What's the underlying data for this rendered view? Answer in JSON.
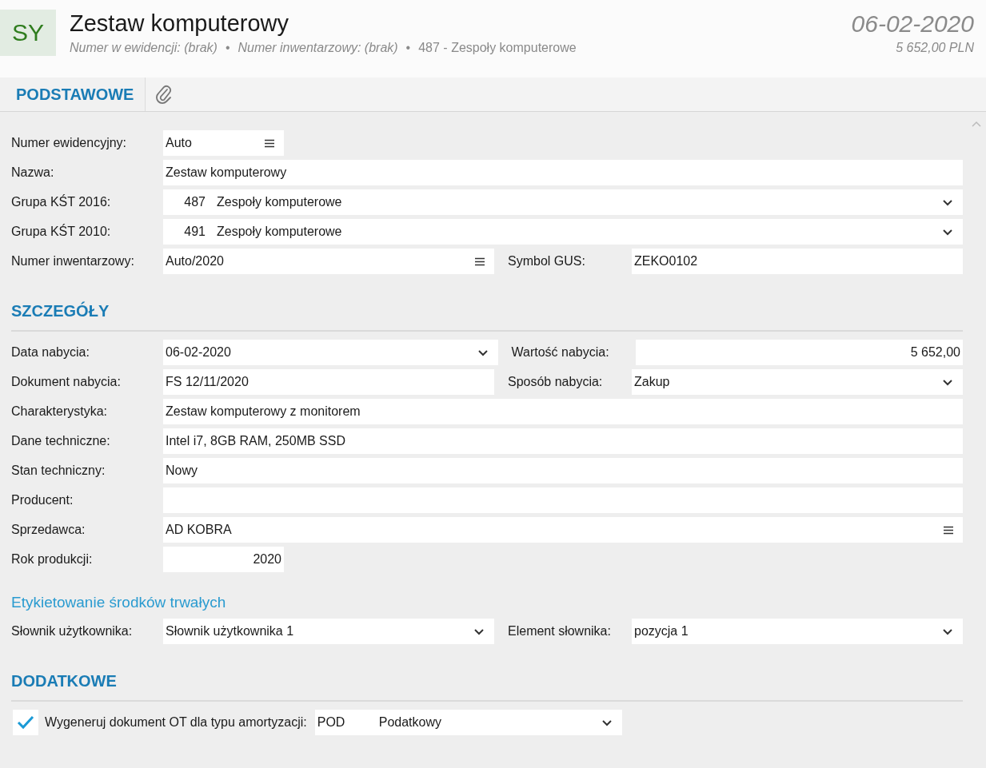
{
  "header": {
    "avatar": "SY",
    "title": "Zestaw komputerowy",
    "date": "06-02-2020",
    "amount": "5 652,00 PLN",
    "subtitle": [
      {
        "text": "Numer w ewidencji: (brak)",
        "italic": true
      },
      {
        "text": "•",
        "italic": false
      },
      {
        "text": "Numer inwentarzowy: (brak)",
        "italic": true
      },
      {
        "text": "•",
        "italic": false
      },
      {
        "text": "487 - Zespoły komputerowe",
        "italic": false
      }
    ]
  },
  "tabs": [
    {
      "kind": "text",
      "label": "PODSTAWOWE",
      "selected": true
    },
    {
      "kind": "attachment",
      "selected": false
    }
  ],
  "sections": [
    {
      "kind": "plain",
      "rows": [
        {
          "kind": "fields",
          "fields": [
            {
              "label": "Numer ewidencyjny:",
              "value": "Auto",
              "kind": "list",
              "narrow": true
            }
          ]
        },
        {
          "kind": "fields",
          "fields": [
            {
              "label": "Nazwa:",
              "value": "Zestaw komputerowy",
              "kind": "text"
            }
          ]
        },
        {
          "kind": "fields",
          "fields": [
            {
              "label": "Grupa KŚT 2016:",
              "code": "487",
              "value": "Zespoły komputerowe",
              "kind": "dropdown"
            }
          ]
        },
        {
          "kind": "fields",
          "fields": [
            {
              "label": "Grupa KŚT 2010:",
              "code": "491",
              "value": "Zespoły komputerowe",
              "kind": "dropdown"
            }
          ]
        },
        {
          "kind": "fields",
          "fields": [
            {
              "label": "Numer inwentarzowy:",
              "value": "Auto/2020",
              "kind": "list"
            },
            {
              "label": "Symbol GUS:",
              "value": "ZEKO0102",
              "kind": "text"
            }
          ]
        }
      ]
    },
    {
      "kind": "heading",
      "title": "SZCZEGÓŁY",
      "rows": [
        {
          "kind": "fields",
          "fields": [
            {
              "label": "Data nabycia:",
              "value": "06-02-2020",
              "kind": "dropdown"
            },
            {
              "label": "Wartość nabycia:",
              "value": "5 652,00",
              "kind": "number"
            }
          ]
        },
        {
          "kind": "fields",
          "fields": [
            {
              "label": "Dokument nabycia:",
              "value": "FS 12/11/2020",
              "kind": "text"
            },
            {
              "label": "Sposób nabycia:",
              "value": "Zakup",
              "kind": "dropdown"
            }
          ]
        },
        {
          "kind": "fields",
          "fields": [
            {
              "label": "Charakterystyka:",
              "value": "Zestaw komputerowy z monitorem",
              "kind": "text"
            }
          ]
        },
        {
          "kind": "fields",
          "fields": [
            {
              "label": "Dane techniczne:",
              "value": "Intel i7, 8GB RAM, 250MB SSD",
              "kind": "text"
            }
          ]
        },
        {
          "kind": "fields",
          "fields": [
            {
              "label": "Stan techniczny:",
              "value": "Nowy",
              "kind": "text"
            }
          ]
        },
        {
          "kind": "fields",
          "fields": [
            {
              "label": "Producent:",
              "kind": "text"
            }
          ]
        },
        {
          "kind": "fields",
          "fields": [
            {
              "label": "Sprzedawca:",
              "value": "AD KOBRA",
              "kind": "list"
            }
          ]
        },
        {
          "kind": "fields",
          "fields": [
            {
              "label": "Rok produkcji:",
              "value": "2020",
              "kind": "number",
              "narrow": true
            }
          ]
        }
      ]
    },
    {
      "kind": "subheading",
      "title": "Etykietowanie środków trwałych",
      "rows": [
        {
          "kind": "fields",
          "fields": [
            {
              "label": "Słownik użytkownika:",
              "value": "Słownik użytkownika 1",
              "kind": "dropdown"
            },
            {
              "label": "Element słownika:",
              "value": "pozycja 1",
              "kind": "dropdown"
            }
          ]
        }
      ]
    },
    {
      "kind": "heading",
      "title": "DODATKOWE",
      "rows": [
        {
          "kind": "checkbox",
          "checked": true,
          "fields": [
            {
              "label": "Wygeneruj dokument OT dla typu amortyzacji:",
              "code": "POD",
              "value": "Podatkowy",
              "kind": "dropdown"
            }
          ]
        }
      ]
    }
  ]
}
